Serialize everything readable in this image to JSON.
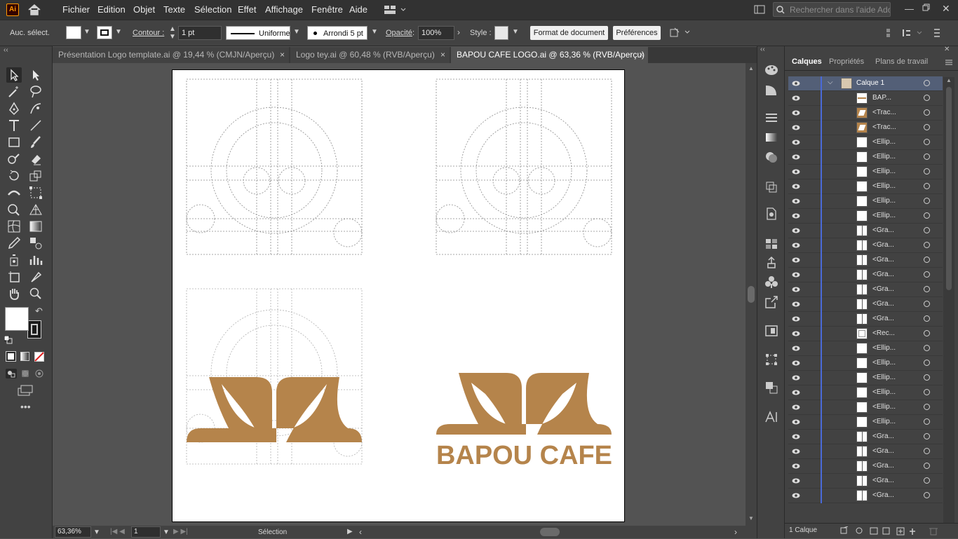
{
  "app": {
    "logo": "Ai"
  },
  "menu": [
    "Fichier",
    "Edition",
    "Objet",
    "Texte",
    "Sélection",
    "Effet",
    "Affichage",
    "Fenêtre",
    "Aide"
  ],
  "search": {
    "placeholder": "Rechercher dans l'aide Adobe"
  },
  "control": {
    "selection": "Auc. sélect.",
    "contour_label": "Contour :",
    "stroke_weight": "1 pt",
    "stroke_profile": "Uniforme",
    "brush": "Arrondi 5 pt",
    "opacity_label": "Opacité",
    "opacity": "100%",
    "style_label": "Style :",
    "doc_button": "Format de document",
    "pref_button": "Préférences"
  },
  "tabs": [
    {
      "label": "Présentation Logo template.ai @ 19,44 % (CMJN/Aperçu)",
      "close": "×"
    },
    {
      "label": "Logo tey.ai @ 60,48 % (RVB/Aperçu)",
      "close": "×"
    },
    {
      "label": "BAPOU CAFE LOGO.ai @ 63,36 % (RVB/Aperçu)",
      "close": "×"
    }
  ],
  "artwork": {
    "brand_text": "BAPOU CAFE",
    "brand_color": "#B5844B"
  },
  "status": {
    "zoom": "63,36%",
    "page": "1",
    "tool": "Sélection"
  },
  "panel": {
    "tabs": [
      "Calques",
      "Propriétés",
      "Plans de travail"
    ],
    "layer_name": "Calque 1",
    "items": [
      "BAP...",
      "<Trac...",
      "<Trac...",
      "<Ellip...",
      "<Ellip...",
      "<Ellip...",
      "<Ellip...",
      "<Ellip...",
      "<Ellip...",
      "<Gra...",
      "<Gra...",
      "<Gra...",
      "<Gra...",
      "<Gra...",
      "<Gra...",
      "<Gra...",
      "<Rec...",
      "<Ellip...",
      "<Ellip...",
      "<Ellip...",
      "<Ellip...",
      "<Ellip...",
      "<Ellip...",
      "<Gra...",
      "<Gra...",
      "<Gra...",
      "<Gra...",
      "<Gra..."
    ],
    "footer": "1 Calque"
  }
}
